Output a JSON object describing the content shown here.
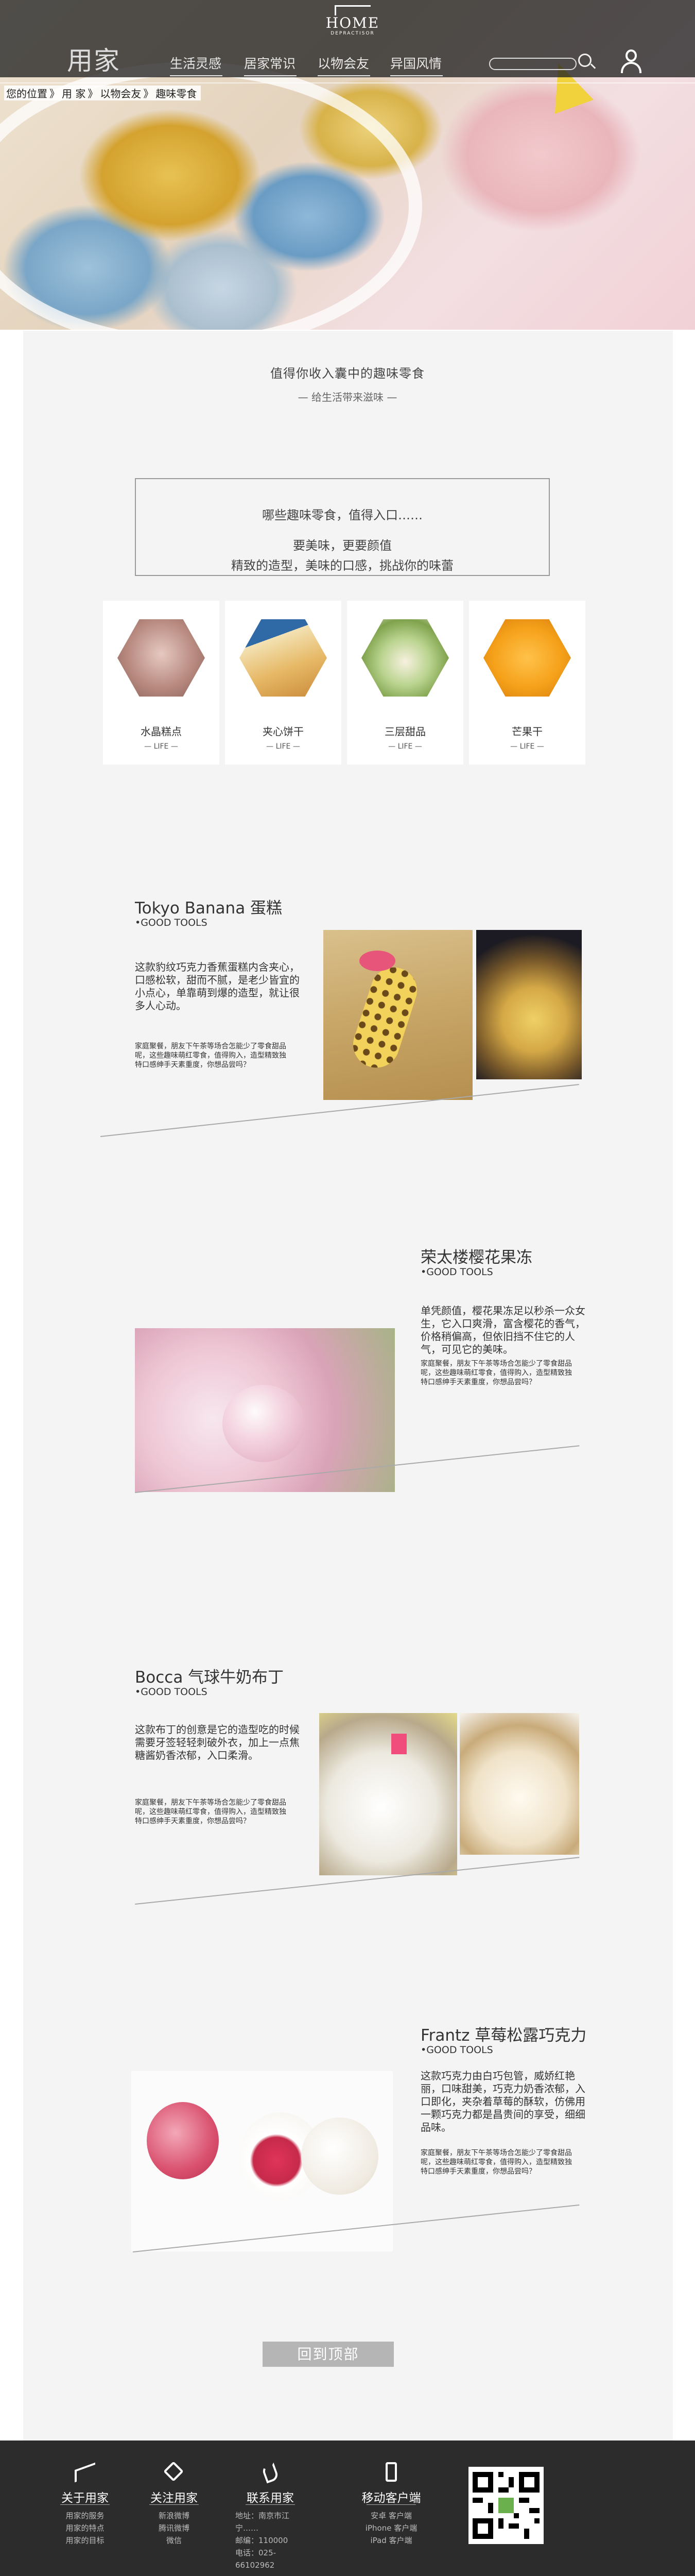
{
  "header": {
    "brand": "用家",
    "logo_word": "HOME",
    "logo_sub": "DEPRACTISOR",
    "nav": [
      "生活灵感",
      "居家常识",
      "以物会友",
      "异国风情"
    ],
    "search": {
      "placeholder": ""
    }
  },
  "breadcrumb": [
    "您的位置",
    "》",
    "用 家",
    "》",
    "以物会友",
    "》",
    "趣味零食"
  ],
  "intro": {
    "title": "值得你收入囊中的趣味零食",
    "subtitle": "— 给生活带来滋味 —"
  },
  "notice": {
    "line1": "哪些趣味零食，值得入口……",
    "line2": "要美味，更要颜值",
    "line3": "精致的造型，美味的口感，挑战你的味蕾"
  },
  "cards": [
    {
      "name": "水晶糕点",
      "tag": "— LIFE —",
      "color": "#b88a80"
    },
    {
      "name": "夹心饼干",
      "tag": "— LIFE —",
      "color": "#d9a24e"
    },
    {
      "name": "三层甜品",
      "tag": "— LIFE —",
      "color": "#9cbb6a"
    },
    {
      "name": "芒果干",
      "tag": "— LIFE —",
      "color": "#f0a51c"
    }
  ],
  "sections": [
    {
      "title": "Tokyo Banana 蛋糕",
      "sub": "•GOOD TOOLS",
      "body": "这款豹纹巧克力香蕉蛋糕内含夹心，口感松软，甜而不腻，是老少皆宜的小点心，单靠萌到爆的造型，就让很多人心动。",
      "note": "家庭聚餐，朋友下午茶等场合怎能少了零食甜品呢，这些趣味萌红零食，值得购入，造型精致独特口感绅手天素重度，你想品尝吗？"
    },
    {
      "title": "荣太楼樱花果冻",
      "sub": "•GOOD TOOLS",
      "body": "单凭颜值，樱花果冻足以秒杀一众女生，它入口爽滑，富含樱花的香气，价格稍偏高，但依旧挡不住它的人气，可见它的美味。",
      "note": "家庭聚餐，朋友下午茶等场合怎能少了零食甜品呢，这些趣味萌红零食，值得购入，造型精致独特口感绅手天素重度，你想品尝吗？"
    },
    {
      "title": "Bocca 气球牛奶布丁",
      "sub": "•GOOD TOOLS",
      "body": "这款布丁的创意是它的造型吃的时候需要牙签轻轻刺破外衣，加上一点焦糖酱奶香浓郁，入口柔滑。",
      "note": "家庭聚餐，朋友下午茶等场合怎能少了零食甜品呢，这些趣味萌红零食，值得购入，造型精致独特口感绅手天素重度，你想品尝吗？"
    },
    {
      "title": "Frantz 草莓松露巧克力",
      "sub": "•GOOD TOOLS",
      "body": "这款巧克力由白巧包管，威娇红艳丽，口味甜美，巧克力奶香浓郁，入口即化，夹杂着草莓的酥软，仿佛用一颗巧克力都是昌贵间的享受，细细品味。",
      "note": "家庭聚餐，朋友下午茶等场合怎能少了零食甜品呢，这些趣味萌红零食，值得购入，造型精致独特口感绅手天素重度，你想品尝吗？"
    }
  ],
  "back_to_top": "回到顶部",
  "footer": {
    "cols": [
      {
        "title": "关于用家",
        "items": [
          "用家的服务",
          "用家的特点",
          "用家的目标"
        ]
      },
      {
        "title": "关注用家",
        "items": [
          "新浪微博",
          "腾讯微博",
          "微信"
        ]
      },
      {
        "title": "联系用家",
        "items": [
          "地址：南京市江宁……",
          "邮编：110000",
          "电话：025-66102962"
        ]
      },
      {
        "title": "移动客户端",
        "items": [
          "安卓 客户端",
          "iPhone 客户端",
          "iPad 客户端"
        ]
      }
    ]
  }
}
